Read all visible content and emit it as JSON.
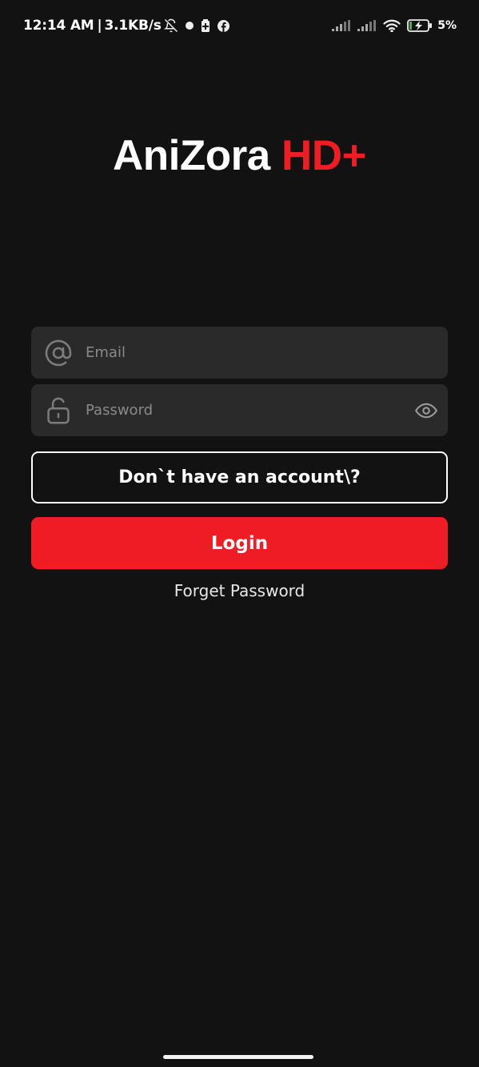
{
  "status_bar": {
    "time": "12:14 AM",
    "separator": "|",
    "speed": "3.1KB/s",
    "battery_percent": "5%",
    "icons": [
      "bell-off-icon",
      "notification-dot-icon",
      "battery-saver-icon",
      "facebook-icon",
      "signal-icon",
      "signal-icon",
      "wifi-icon",
      "battery-charging-icon"
    ]
  },
  "logo": {
    "part1": "AniZora",
    "part2": "HD+"
  },
  "form": {
    "email_placeholder": "Email",
    "email_value": "",
    "password_placeholder": "Password",
    "password_value": ""
  },
  "buttons": {
    "signup_label": "Don`t have an account\\?",
    "login_label": "Login",
    "forget_label": "Forget Password"
  },
  "colors": {
    "background": "#121212",
    "field": "#2a2a2a",
    "accent": "#f01c24"
  }
}
